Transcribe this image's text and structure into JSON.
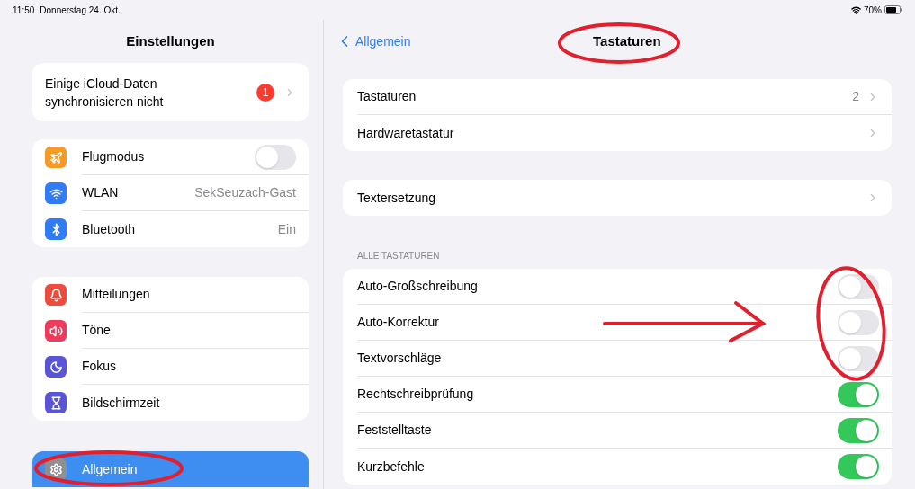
{
  "status_bar": {
    "time": "11:50",
    "date": "Donnerstag 24. Okt.",
    "battery": "70%"
  },
  "sidebar": {
    "title": "Einstellungen",
    "notice": {
      "label": "Einige iCloud-Daten synchronisieren nicht",
      "badge": "1"
    },
    "groups": [
      {
        "items": [
          {
            "label": "Flugmodus",
            "kind": "toggle",
            "on": false,
            "color": "#f59a27",
            "selected": false
          },
          {
            "label": "WLAN",
            "kind": "value",
            "value": "SekSeuzach-Gast",
            "color": "#2f7cf6",
            "selected": false
          },
          {
            "label": "Bluetooth",
            "kind": "value",
            "value": "Ein",
            "color": "#2f7cf6",
            "selected": false
          }
        ]
      },
      {
        "items": [
          {
            "label": "Mitteilungen",
            "kind": "link",
            "color": "#ee4b3c",
            "selected": false
          },
          {
            "label": "Töne",
            "kind": "link",
            "color": "#ee3b5b",
            "selected": false
          },
          {
            "label": "Fokus",
            "kind": "link",
            "color": "#5a55d6",
            "selected": false
          },
          {
            "label": "Bildschirmzeit",
            "kind": "link",
            "color": "#5a55d6",
            "selected": false
          }
        ]
      },
      {
        "items": [
          {
            "label": "Allgemein",
            "kind": "link",
            "color": "#8e8e93",
            "selected": true
          }
        ]
      }
    ]
  },
  "detail": {
    "back": "Allgemein",
    "title": "Tastaturen",
    "groups": [
      {
        "items": [
          {
            "label": "Tastaturen",
            "kind": "link",
            "value": "2"
          },
          {
            "label": "Hardwaretastatur",
            "kind": "link"
          }
        ]
      },
      {
        "items": [
          {
            "label": "Textersetzung",
            "kind": "link"
          }
        ]
      },
      {
        "header": "ALLE TASTATUREN",
        "items": [
          {
            "label": "Auto-Großschreibung",
            "kind": "toggle",
            "on": false
          },
          {
            "label": "Auto-Korrektur",
            "kind": "toggle",
            "on": false
          },
          {
            "label": "Textvorschläge",
            "kind": "toggle",
            "on": false
          },
          {
            "label": "Rechtschreibprüfung",
            "kind": "toggle",
            "on": true
          },
          {
            "label": "Feststelltaste",
            "kind": "toggle",
            "on": true
          },
          {
            "label": "Kurzbefehle",
            "kind": "toggle",
            "on": true
          }
        ]
      }
    ]
  }
}
